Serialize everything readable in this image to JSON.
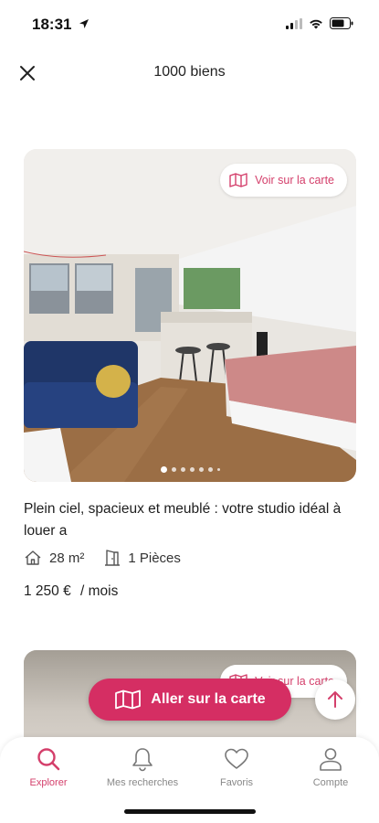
{
  "status_bar": {
    "time": "18:31"
  },
  "header": {
    "title": "1000 biens"
  },
  "listing": {
    "map_chip_label": "Voir sur la carte",
    "title": "Plein ciel, spacieux et meublé : votre studio idéal à louer a",
    "area": "28 m²",
    "rooms": "1 Pièces",
    "price": "1 250 €",
    "price_period": "/ mois",
    "carousel": {
      "count": 7,
      "active_index": 0
    }
  },
  "listing2": {
    "map_chip_label": "Voir sur la carte"
  },
  "cta": {
    "label": "Aller sur la carte"
  },
  "tabs": [
    {
      "label": "Explorer",
      "icon": "search-icon",
      "active": true
    },
    {
      "label": "Mes recherches",
      "icon": "bell-icon",
      "active": false
    },
    {
      "label": "Favoris",
      "icon": "heart-icon",
      "active": false
    },
    {
      "label": "Compte",
      "icon": "user-icon",
      "active": false
    }
  ],
  "colors": {
    "accent": "#d52e63",
    "inactive": "#888888"
  }
}
